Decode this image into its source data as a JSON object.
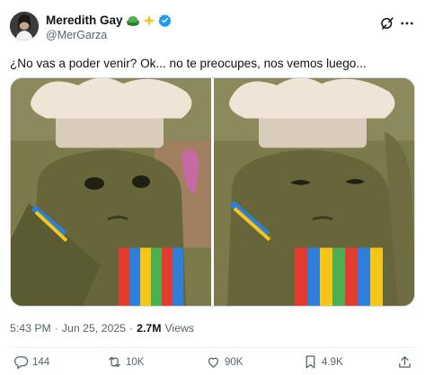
{
  "author": {
    "display_name": "Meredith Gay",
    "handle": "@MerGarza",
    "emoji_icons": [
      "chef-hat-emoji-icon",
      "sparkles-emoji-icon"
    ],
    "verified_color": "#1d9bf0"
  },
  "tweet": {
    "text": "¿No vas a poder venir? Ok... no te preocupes, nos vemos luego..."
  },
  "media": [
    {
      "icon": "puppet-chef-photo-1",
      "expression": "neutral face"
    },
    {
      "icon": "puppet-chef-photo-2",
      "expression": "sad sideways glance"
    }
  ],
  "meta": {
    "time": "5:43 PM",
    "separator": "·",
    "date": "Jun 25, 2025",
    "views_count": "2.7M",
    "views_label": "Views"
  },
  "actions": {
    "replies": "144",
    "reposts": "10K",
    "likes": "90K",
    "bookmarks": "4.9K"
  },
  "colors": {
    "text_primary": "#0f1419",
    "text_secondary": "#536471",
    "border": "#cfd9de"
  }
}
